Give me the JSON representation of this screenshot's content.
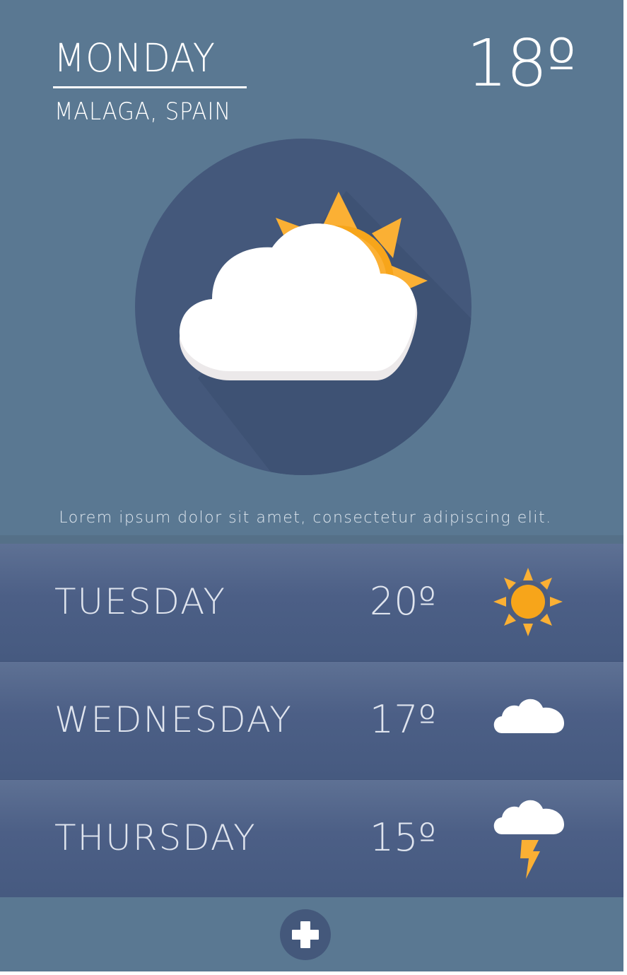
{
  "header": {
    "day": "MONDAY",
    "location": "MALAGA, SPAIN",
    "temperature": "18º"
  },
  "current": {
    "icon": "partly-cloudy-icon",
    "description": "Lorem ipsum dolor sit amet, consectetur adipiscing elit."
  },
  "forecast": [
    {
      "day": "TUESDAY",
      "temperature": "20º",
      "icon": "sun-icon"
    },
    {
      "day": "WEDNESDAY",
      "temperature": "17º",
      "icon": "cloud-icon"
    },
    {
      "day": "THURSDAY",
      "temperature": "15º",
      "icon": "storm-icon"
    }
  ],
  "footer": {
    "add_icon": "plus-icon"
  },
  "colors": {
    "background": "#5a7892",
    "forecast_row": "#4c5f86",
    "circle": "#44587b",
    "sun": "#fba919",
    "sun_light": "#fdb93a",
    "cloud": "#ffffff"
  }
}
